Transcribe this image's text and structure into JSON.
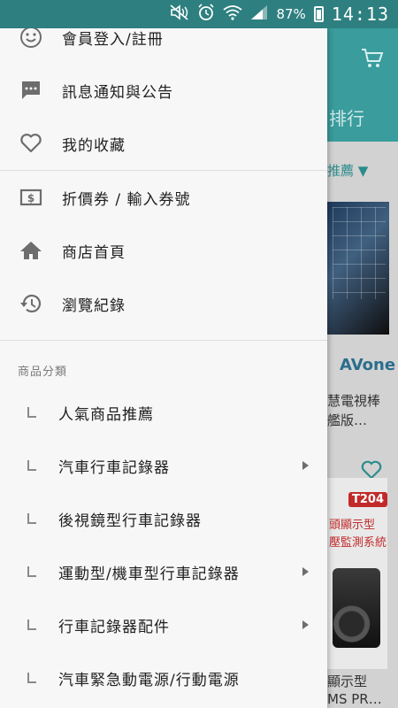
{
  "status_bar": {
    "battery_percent": "87%",
    "time": "14:13",
    "icons": [
      "mute-icon",
      "alarm-icon",
      "wifi-icon",
      "signal-icon",
      "battery-icon"
    ]
  },
  "drawer": {
    "account_items": [
      {
        "label": "會員登入/註冊",
        "icon": "smiley-icon"
      },
      {
        "label": "訊息通知與公告",
        "icon": "message-icon"
      },
      {
        "label": "我的收藏",
        "icon": "heart-icon"
      }
    ],
    "shop_items": [
      {
        "label": "折價券 / 輸入券號",
        "icon": "coupon-icon"
      },
      {
        "label": "商店首頁",
        "icon": "home-icon"
      },
      {
        "label": "瀏覽紀錄",
        "icon": "history-icon"
      }
    ],
    "category_title": "商品分類",
    "categories": [
      {
        "label": "人氣商品推薦",
        "has_submenu": false
      },
      {
        "label": "汽車行車記錄器",
        "has_submenu": true
      },
      {
        "label": "後視鏡型行車記錄器",
        "has_submenu": false
      },
      {
        "label": "運動型/機車型行車記錄器",
        "has_submenu": true
      },
      {
        "label": "行車記錄器配件",
        "has_submenu": true
      },
      {
        "label": "汽車緊急動電源/行動電源",
        "has_submenu": false
      }
    ]
  },
  "background_app": {
    "tab_fragment": "排行",
    "recommend_fragment": "推薦",
    "product1_brand": "AVone",
    "product1_text": [
      "慧電視棒",
      "艦版…"
    ],
    "product2_badge": "T204",
    "product2_promo": [
      "頭顯示型",
      "壓監測系統"
    ],
    "product2_text": [
      "顯示型",
      "MS PR…"
    ]
  },
  "colors": {
    "accent": "#3a9c9c",
    "status_bar": "#2e7f80",
    "drawer_bg": "#f7f7f7",
    "icon_gray": "#6d6d6d"
  }
}
